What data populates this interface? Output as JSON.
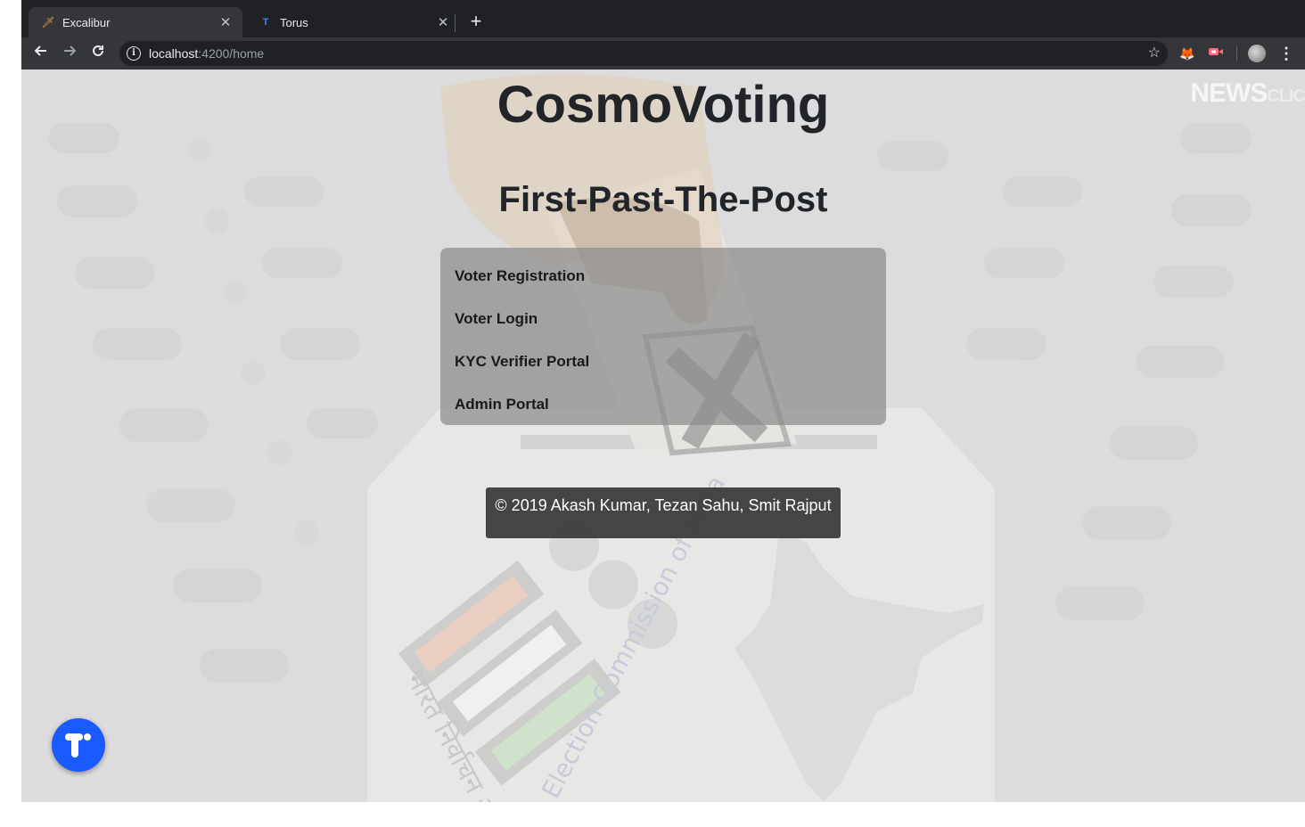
{
  "browser": {
    "tabs": [
      {
        "title": "Excalibur",
        "favicon": "sword-icon",
        "active": true
      },
      {
        "title": "Torus",
        "favicon": "torus-logo-icon",
        "active": false
      }
    ],
    "close_glyph": "✕",
    "new_tab_glyph": "+",
    "url_host": "localhost",
    "url_path": ":4200/home"
  },
  "page": {
    "title": "CosmoVoting",
    "subtitle": "First-Past-The-Post",
    "menu": [
      {
        "label": "Voter Registration"
      },
      {
        "label": "Voter Login"
      },
      {
        "label": "KYC Verifier Portal"
      },
      {
        "label": "Admin Portal"
      }
    ],
    "footer": "© 2019 Akash Kumar, Tezan Sahu, Smit Rajput",
    "watermark": {
      "main": "NEWS",
      "suffix": "CLIC"
    }
  },
  "colors": {
    "accent_fab": "#1a5bff",
    "panel": "#8c8c8c",
    "footer_bg": "#373737"
  }
}
